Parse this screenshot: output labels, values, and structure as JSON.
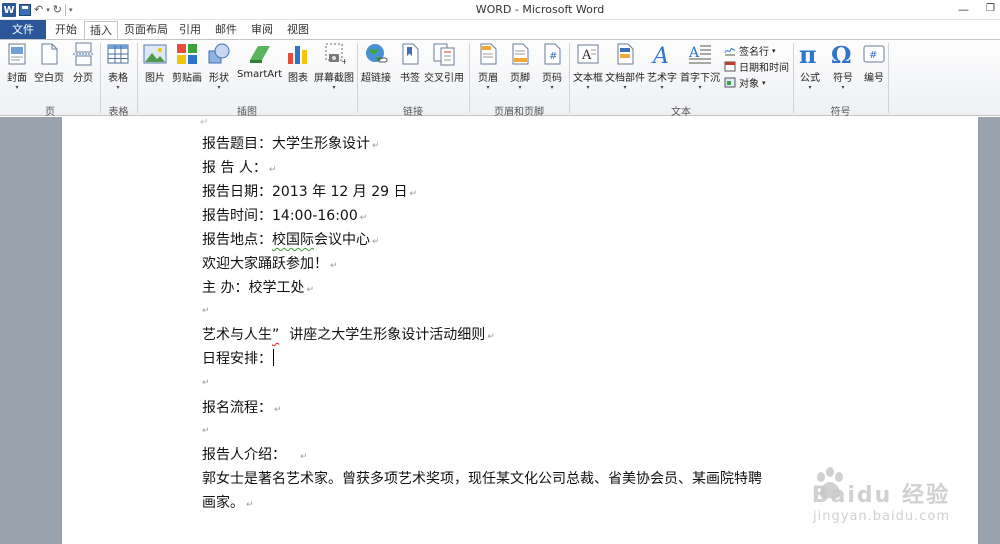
{
  "window": {
    "title": "WORD - Microsoft Word",
    "app_icon_letter": "W"
  },
  "tabs": [
    "文件",
    "开始",
    "插入",
    "页面布局",
    "引用",
    "邮件",
    "审阅",
    "视图"
  ],
  "active_tab": "插入",
  "ribbon": {
    "groups": {
      "pages": {
        "label": "页",
        "buttons": [
          "封面",
          "空白页",
          "分页"
        ]
      },
      "tables": {
        "label": "表格",
        "buttons": [
          "表格"
        ]
      },
      "illustrations": {
        "label": "插图",
        "buttons": [
          "图片",
          "剪贴画",
          "形状",
          "SmartArt",
          "图表",
          "屏幕截图"
        ]
      },
      "links": {
        "label": "链接",
        "buttons": [
          "超链接",
          "书签",
          "交叉引用"
        ]
      },
      "header_footer": {
        "label": "页眉和页脚",
        "buttons": [
          "页眉",
          "页脚",
          "页码"
        ]
      },
      "text": {
        "label": "文本",
        "buttons": [
          "文本框",
          "文档部件",
          "艺术字",
          "首字下沉"
        ],
        "small_items": [
          "签名行",
          "日期和时间",
          "对象"
        ]
      },
      "symbols": {
        "label": "符号",
        "buttons": [
          "公式",
          "符号",
          "编号"
        ]
      }
    }
  },
  "document": {
    "lines": {
      "l1": "报告题目：大学生形象设计",
      "l2": "报  告  人：",
      "l3": "报告日期：2013 年 12 月 29 日",
      "l4": "报告时间：14:00-16:00",
      "l5a": "报告地点：",
      "l5b": "校国际",
      "l5c": "会议中心",
      "l6": "欢迎大家踊跃参加！",
      "l7": "主  办：校学工处",
      "l8a": "艺术与人生",
      "l8b": "”",
      "l8c": "讲座之大学生形象设计活动细则",
      "l9": "日程安排：",
      "l10": "报名流程：",
      "l11": "报告人介绍：",
      "l12": "郭女士是著名艺术家。曾获多项艺术奖项，现任某文化公司总裁、省美协会员、某画院特聘",
      "l13": "画家。"
    },
    "paragraph_mark": "↵"
  },
  "watermark": {
    "brand": "Baidu 经验",
    "url": "jingyan.baidu.com"
  },
  "colors": {
    "file_tab": "#2b579a",
    "doc_background": "#9aa3ad",
    "grammar_squiggle": "#3a9a3a",
    "spelling_squiggle": "#dd2222"
  }
}
